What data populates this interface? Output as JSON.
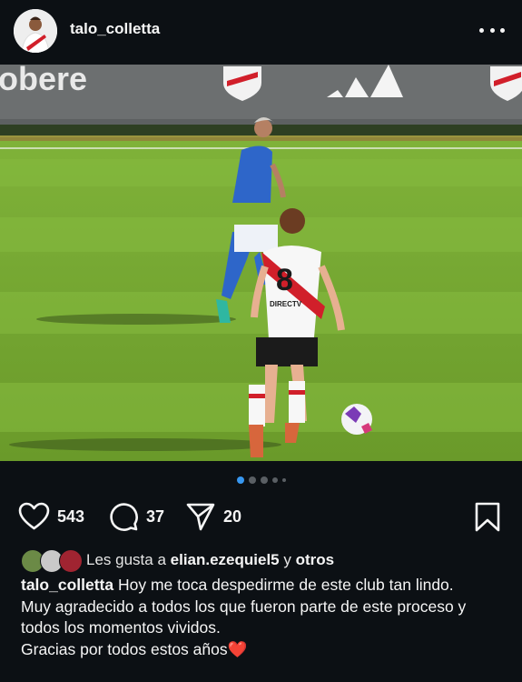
{
  "post": {
    "username": "talo_colletta",
    "avatar_icon": "profile-avatar",
    "more_icon": "ellipsis-icon"
  },
  "photo": {
    "banner_text": "obere",
    "jersey_number": "8",
    "sponsor_text": "DIRECTV"
  },
  "carousel": {
    "active_index": 0,
    "total": 5,
    "active_color": "#3797f0"
  },
  "actions": {
    "likes_count": "543",
    "comments_count": "37",
    "shares_count": "20",
    "icons": [
      "heart-icon",
      "comment-icon",
      "share-icon",
      "bookmark-icon"
    ]
  },
  "likes": {
    "prefix": "Les gusta a",
    "user": "elian.ezequiel5",
    "conjunction": "y",
    "others": "otros"
  },
  "caption": {
    "username": "talo_colletta",
    "line1": "Hoy me toca despedirme de este club tan lindo.",
    "line2": "Muy agradecido a todos los que fueron parte de este proceso y todos los momentos vividos.",
    "line3": "Gracias por todos estos años",
    "emoji": "❤️"
  },
  "colors": {
    "background": "#0c1014",
    "text": "#f5f5f5",
    "heart": "#e0263a"
  }
}
